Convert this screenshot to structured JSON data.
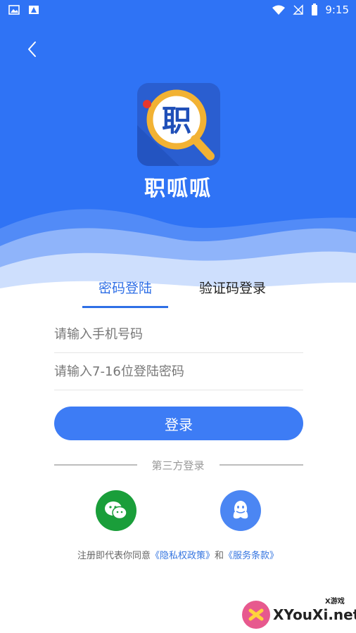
{
  "status_bar": {
    "time": "9:15",
    "battery_level": "9"
  },
  "app": {
    "name": "职呱呱",
    "logo_char": "职",
    "brand_color": "#2f73f5"
  },
  "tabs": [
    {
      "label": "密码登陆",
      "active": true
    },
    {
      "label": "验证码登录",
      "active": false
    }
  ],
  "form": {
    "phone_placeholder": "请输入手机号码",
    "password_placeholder": "请输入7-16位登陆密码",
    "login_label": "登录"
  },
  "third_party": {
    "label": "第三方登录",
    "options": [
      "wechat-icon",
      "qq-icon"
    ]
  },
  "agreement": {
    "prefix": "注册即代表你同意",
    "privacy_link": "《隐私权政策》",
    "conjunction": "和",
    "terms_link": "《服务条款》"
  },
  "watermark": {
    "text": "XYouXi.net",
    "small_text": "X游戏"
  }
}
